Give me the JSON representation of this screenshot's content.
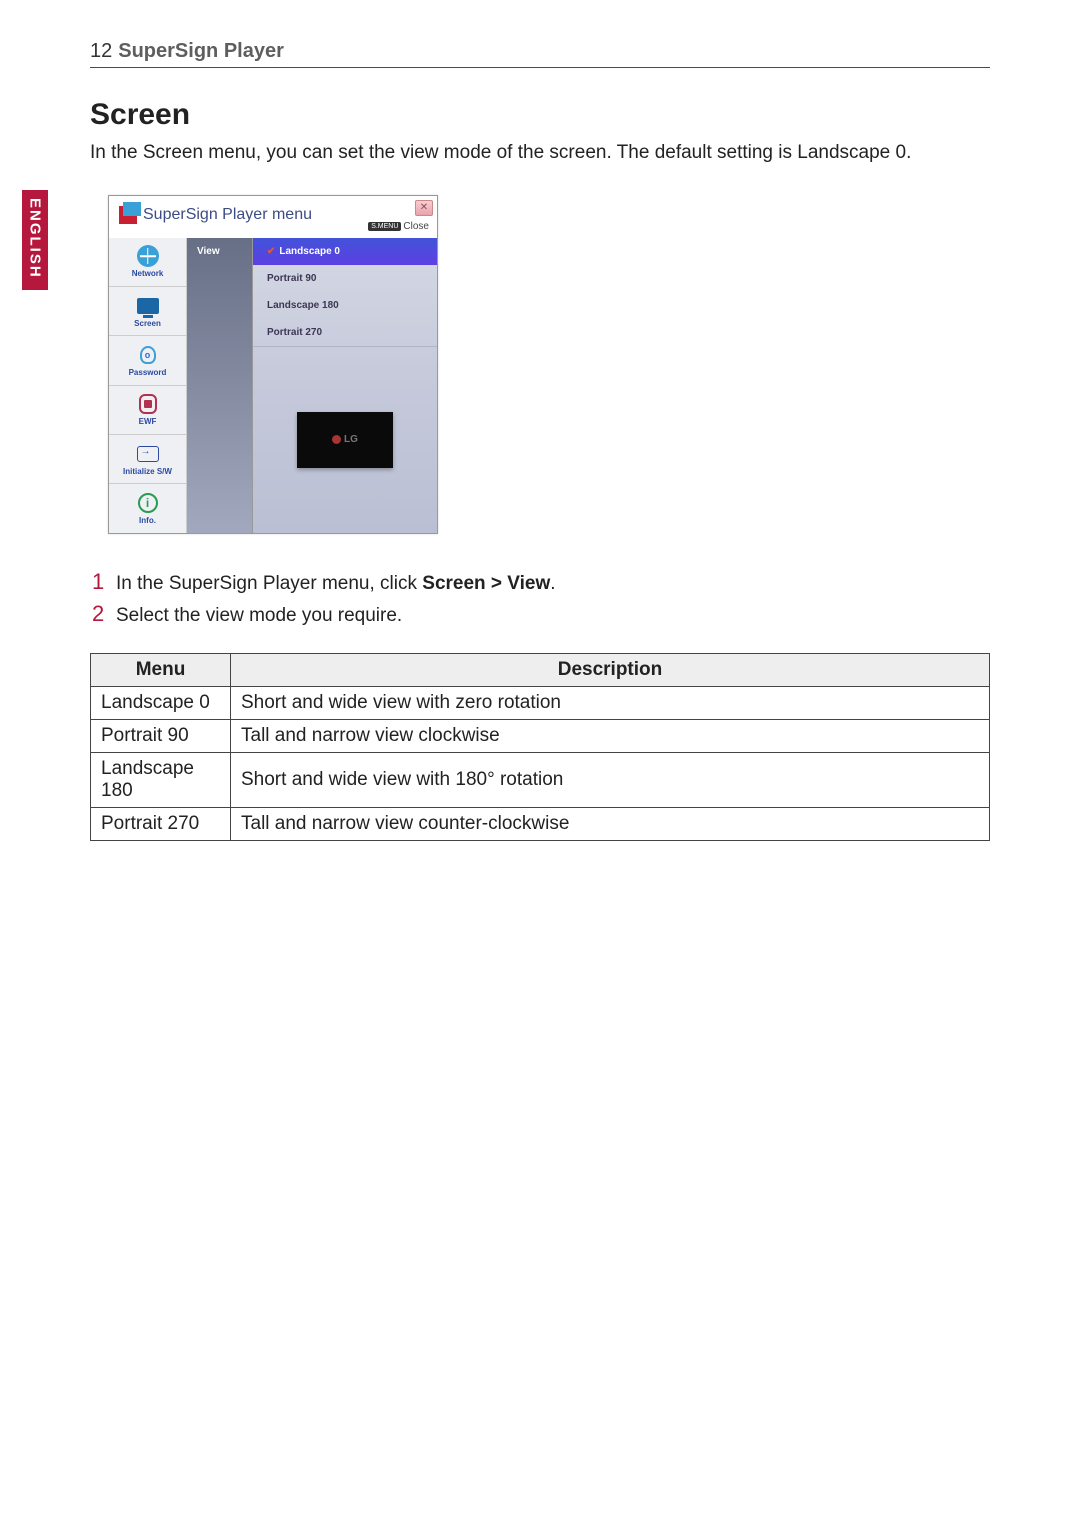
{
  "header": {
    "page_num": "12",
    "title": "SuperSign Player"
  },
  "lang_tab": "ENGLISH",
  "section": {
    "title": "Screen",
    "intro": "In the Screen menu, you can set the view mode of the screen. The default setting is Landscape 0."
  },
  "screenshot": {
    "title": "SuperSign Player menu",
    "smenu_badge": "S.MENU",
    "close_label": "Close",
    "close_x": "✕",
    "sidebar": [
      {
        "label": "Network"
      },
      {
        "label": "Screen"
      },
      {
        "label": "Password"
      },
      {
        "label": "EWF"
      },
      {
        "label": "Initialize S/W"
      },
      {
        "label": "Info."
      }
    ],
    "mid_col": "View",
    "options": [
      "Landscape 0",
      "Portrait 90",
      "Landscape 180",
      "Portrait 270"
    ],
    "preview_brand": "LG"
  },
  "steps": [
    {
      "n": "1",
      "text_pre": "In the SuperSign Player menu, click ",
      "bold": "Screen > View",
      "text_post": "."
    },
    {
      "n": "2",
      "text_pre": "Select the view mode you require.",
      "bold": "",
      "text_post": ""
    }
  ],
  "table": {
    "headers": [
      "Menu",
      "Description"
    ],
    "rows": [
      [
        "Landscape 0",
        "Short and wide view with zero rotation"
      ],
      [
        "Portrait 90",
        "Tall and narrow view clockwise"
      ],
      [
        "Landscape 180",
        "Short and wide view with 180° rotation"
      ],
      [
        "Portrait 270",
        "Tall and narrow view counter-clockwise"
      ]
    ]
  }
}
